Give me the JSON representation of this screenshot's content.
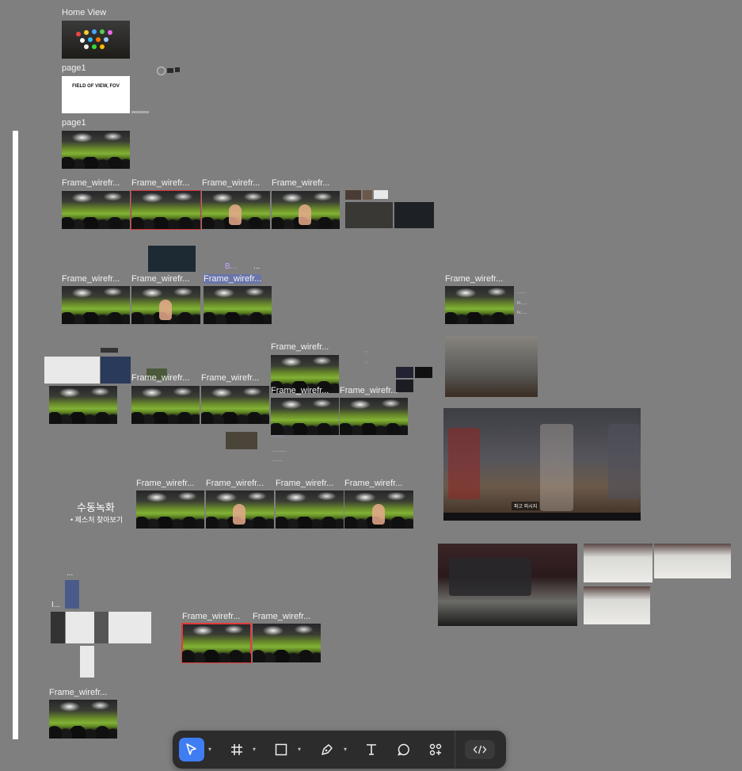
{
  "canvas": {
    "labels": {
      "home_view": "Home View",
      "page1_a": "page1",
      "page1_b": "page1",
      "frame_wire": "Frame_wirefr...",
      "ellipsis": "...",
      "ellipsis_i": "I...",
      "b_label": "B...",
      "fov_title": "FIELD OF VIEW, FOV",
      "korean_title": "수동녹화",
      "korean_sub": "• 제스처 찾아보기",
      "video_caption": "파고 피시지"
    }
  },
  "toolbar": {
    "tools": [
      {
        "name": "move-tool",
        "icon": "pointer-icon",
        "active": true
      },
      {
        "name": "frame-tool",
        "icon": "frame-icon",
        "active": false
      },
      {
        "name": "shape-tool",
        "icon": "rectangle-icon",
        "active": false
      },
      {
        "name": "pen-tool",
        "icon": "pen-icon",
        "active": false
      },
      {
        "name": "text-tool",
        "icon": "text-icon",
        "active": false
      },
      {
        "name": "comment-tool",
        "icon": "comment-icon",
        "active": false
      },
      {
        "name": "actions-tool",
        "icon": "components-icon",
        "active": false
      },
      {
        "name": "dev-mode-toggle",
        "icon": "code-icon",
        "active": false
      }
    ],
    "accent": "#3f7df3"
  },
  "colors": {
    "canvas_bg": "#7f7f7f",
    "selection": "#e23b3b",
    "toolbar_bg": "#2c2c2c"
  }
}
